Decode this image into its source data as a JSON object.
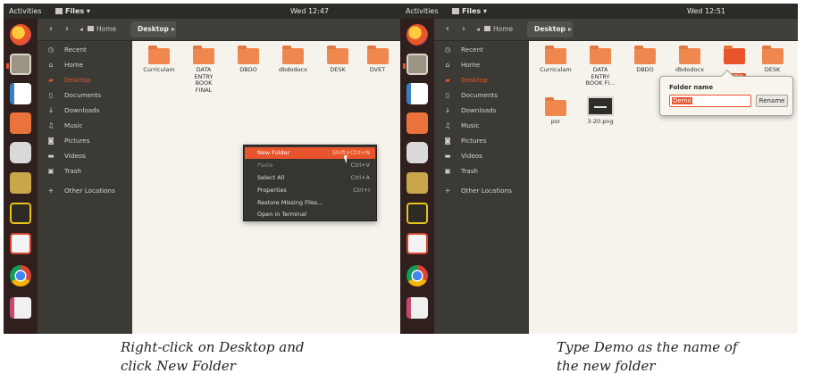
{
  "left_shot": {
    "topbar": {
      "activities": "Activities",
      "app_menu": "Files ▾",
      "clock": "Wed 12:47"
    },
    "breadcrumb": {
      "home": "Home",
      "current": "Desktop"
    },
    "sidebar": [
      {
        "icon": "clock-icon",
        "glyph": "◷",
        "label": "Recent"
      },
      {
        "icon": "home-icon",
        "glyph": "⌂",
        "label": "Home"
      },
      {
        "icon": "folder-icon",
        "glyph": "▰",
        "label": "Desktop",
        "selected": true
      },
      {
        "icon": "document-icon",
        "glyph": "▯",
        "label": "Documents"
      },
      {
        "icon": "download-icon",
        "glyph": "↓",
        "label": "Downloads"
      },
      {
        "icon": "music-icon",
        "glyph": "♫",
        "label": "Music"
      },
      {
        "icon": "camera-icon",
        "glyph": "◙",
        "label": "Pictures"
      },
      {
        "icon": "video-icon",
        "glyph": "▬",
        "label": "Videos"
      },
      {
        "icon": "trash-icon",
        "glyph": "▣",
        "label": "Trash"
      },
      {
        "icon": "plus-icon",
        "glyph": "+",
        "label": "Other Locations"
      }
    ],
    "files": [
      "Curriculam",
      "DATA ENTRY BOOK FINAL",
      "DBDO",
      "dbdodocx",
      "DESK",
      "DVET"
    ],
    "context_menu": [
      {
        "label": "New Folder",
        "shortcut": "Shift+Ctrl+N",
        "highlighted": true
      },
      {
        "label": "Paste",
        "shortcut": "Ctrl+V",
        "disabled": true
      },
      {
        "label": "Select All",
        "shortcut": "Ctrl+A"
      },
      {
        "label": "Properties",
        "shortcut": "Ctrl+I"
      },
      {
        "label": "Restore Missing Files...",
        "shortcut": ""
      },
      {
        "label": "Open in Terminal",
        "shortcut": ""
      }
    ],
    "caption": [
      "Right-click on Desktop and",
      "click New Folder"
    ]
  },
  "right_shot": {
    "topbar": {
      "activities": "Activities",
      "app_menu": "Files ▾",
      "clock": "Wed 12:51"
    },
    "breadcrumb": {
      "home": "Home",
      "current": "Desktop"
    },
    "sidebar": [
      {
        "icon": "clock-icon",
        "glyph": "◷",
        "label": "Recent"
      },
      {
        "icon": "home-icon",
        "glyph": "⌂",
        "label": "Home"
      },
      {
        "icon": "folder-icon",
        "glyph": "▰",
        "label": "Desktop",
        "selected": true
      },
      {
        "icon": "document-icon",
        "glyph": "▯",
        "label": "Documents"
      },
      {
        "icon": "download-icon",
        "glyph": "↓",
        "label": "Downloads"
      },
      {
        "icon": "music-icon",
        "glyph": "♫",
        "label": "Music"
      },
      {
        "icon": "camera-icon",
        "glyph": "◙",
        "label": "Pictures"
      },
      {
        "icon": "video-icon",
        "glyph": "▬",
        "label": "Videos"
      },
      {
        "icon": "trash-icon",
        "glyph": "▣",
        "label": "Trash"
      },
      {
        "icon": "plus-icon",
        "glyph": "+",
        "label": "Other Locations"
      }
    ],
    "files": [
      "Curriculam",
      "DATA ENTRY BOOK FI...",
      "DBDO",
      "dbdodocx",
      "Demo",
      "DESK",
      "por",
      "3-20.png"
    ],
    "rename_popover": {
      "title": "Folder name",
      "value": "Demo",
      "button": "Rename"
    },
    "caption": [
      "Type Demo as the name of",
      "the new folder"
    ]
  },
  "dock_apps": [
    "firefox",
    "files",
    "writer",
    "impress",
    "camera",
    "archive",
    "inkscape",
    "eclipse",
    "chrome",
    "library"
  ],
  "colors": {
    "accent": "#e8542b",
    "sidebar": "#3b3a35",
    "topbar": "#2c2b28",
    "dock": "#2f1f1d"
  }
}
